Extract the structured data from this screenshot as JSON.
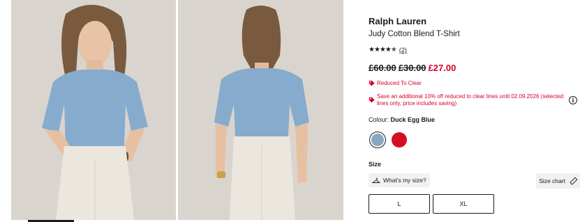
{
  "gallery": {
    "images": [
      {
        "name": "front-view",
        "description": "model-front"
      },
      {
        "name": "back-view",
        "description": "model-back"
      }
    ],
    "current_index": 1,
    "total": 2
  },
  "product": {
    "brand": "Ralph Lauren",
    "name": "Judy Cotton Blend T-Shirt",
    "rating": 4.5,
    "review_count": "(2)",
    "old_prices": [
      "£60.00",
      "£30.00"
    ],
    "current_price": "£27.00"
  },
  "promotions": {
    "reduced": "Reduced To Clear",
    "additional": "Save an additional 10% off reduced to clear lines until 02.09.2026 (selected lines only, price includes saving)",
    "icon": "tag-icon",
    "info_icon": "info-icon"
  },
  "colour": {
    "label": "Colour:",
    "selected": "Duck Egg Blue",
    "swatches": [
      {
        "name": "Duck Egg Blue",
        "color": "#8aa7bf",
        "selected": true
      },
      {
        "name": "Red",
        "color": "#d40f22",
        "selected": false
      }
    ]
  },
  "size": {
    "label": "Size",
    "whats_my_size": "What's my size?",
    "size_chart": "Size chart",
    "options": [
      "L",
      "XL"
    ]
  },
  "colors": {
    "sale_red": "#d4002a",
    "text": "#1a1a1a"
  }
}
